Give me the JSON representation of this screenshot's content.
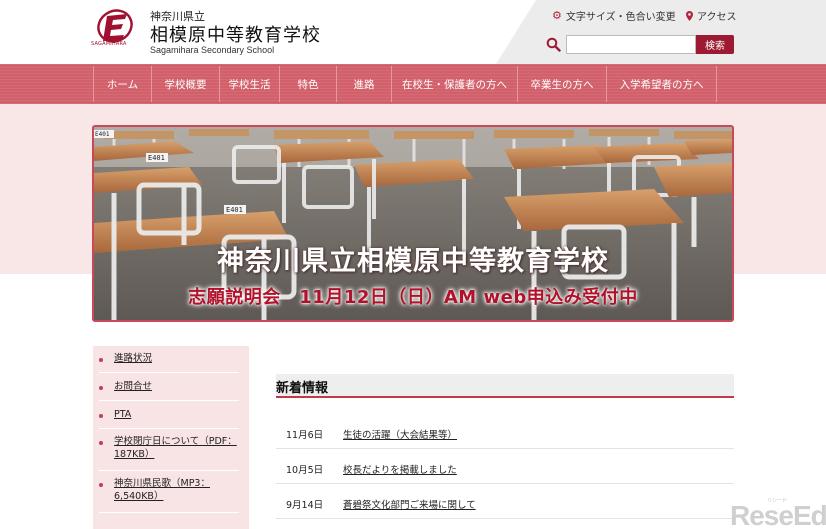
{
  "header": {
    "logo_caption": "SAGAMIHARA",
    "prefecture": "神奈川県立",
    "school_name": "相模原中等教育学校",
    "school_name_en": "Sagamihara Secondary School",
    "font_size_link": "文字サイズ・色合い変更",
    "access_link": "アクセス",
    "search_placeholder": "",
    "search_button": "検索"
  },
  "nav": {
    "items": [
      {
        "label": "ホーム"
      },
      {
        "label": "学校概要"
      },
      {
        "label": "学校生活"
      },
      {
        "label": "特色"
      },
      {
        "label": "進路"
      },
      {
        "label": "在校生・保護者の方へ"
      },
      {
        "label": "卒業生の方へ"
      },
      {
        "label": "入学希望者の方へ"
      }
    ]
  },
  "hero": {
    "title": "神奈川県立相模原中等教育学校",
    "subtitle": "志願説明会　11月12日（日）AM web申込み受付中",
    "desk_labels": [
      "E401",
      "E401",
      "E401"
    ]
  },
  "side_menu": {
    "items": [
      {
        "label": "進路状況"
      },
      {
        "label": "お問合せ"
      },
      {
        "label": "PTA"
      },
      {
        "label": "学校閉庁日について（PDF：187KB）"
      },
      {
        "label": "神奈川県民歌（MP3：6,540KB）"
      }
    ]
  },
  "news": {
    "heading": "新着情報",
    "items": [
      {
        "date": "11月6日",
        "title": "生徒の活躍（大会結果等）"
      },
      {
        "date": "10月5日",
        "title": "校長だよりを掲載しました"
      },
      {
        "date": "9月14日",
        "title": "蒼碧祭文化部門ご来場に関して"
      }
    ]
  },
  "watermark": {
    "text": "ReseEd",
    "small": "リシード"
  },
  "colors": {
    "brand": "#9d1b32",
    "nav": "#d2606b",
    "band": "#f9e6e7"
  }
}
